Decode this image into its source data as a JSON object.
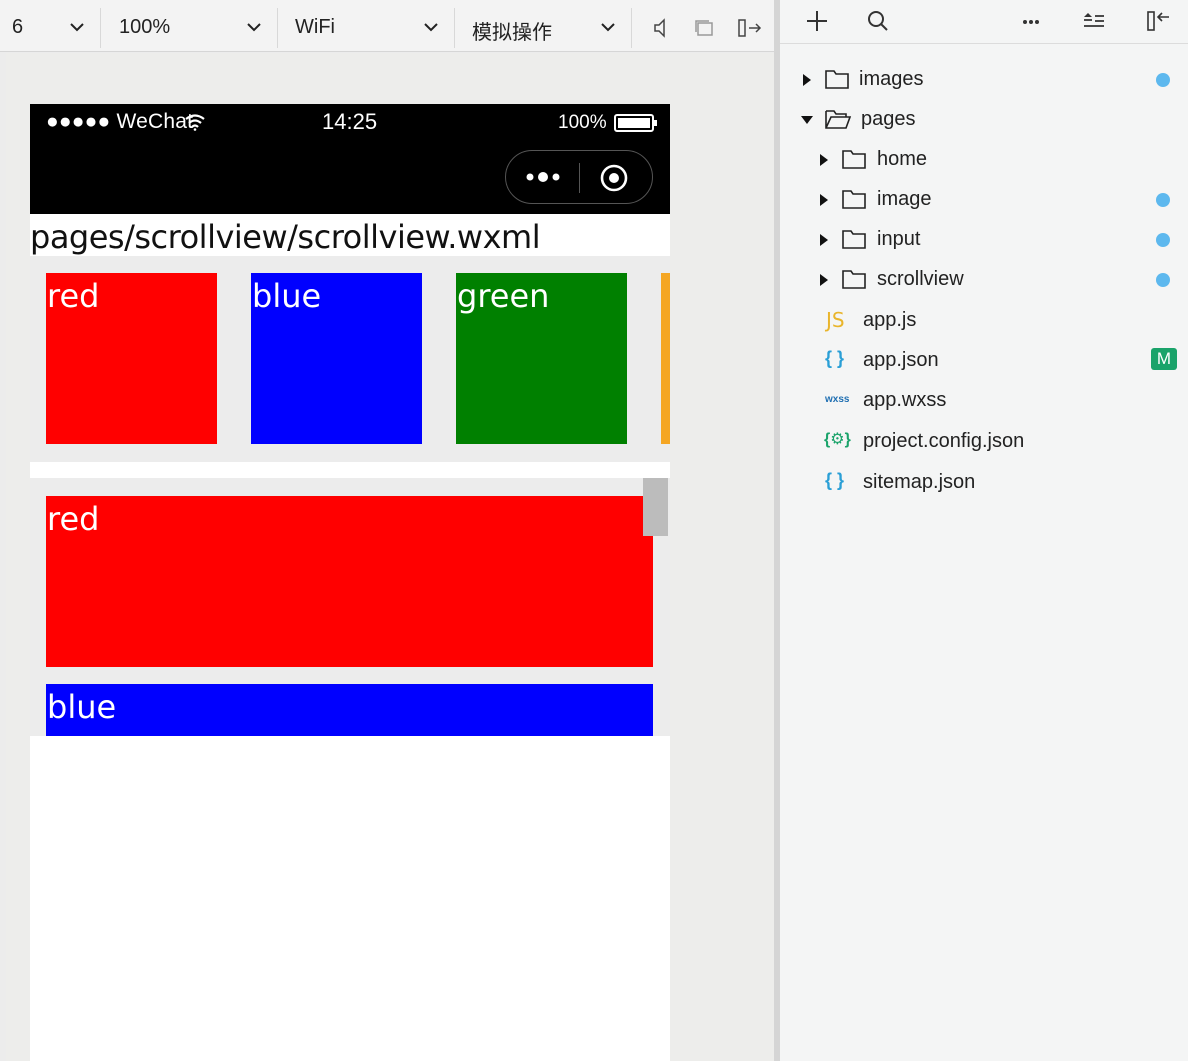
{
  "toolbar": {
    "device_value": "6",
    "zoom_value": "100%",
    "network_value": "WiFi",
    "simulate_value": "模拟操作"
  },
  "phone": {
    "carrier": "●●●●● WeChat",
    "time": "14:25",
    "battery_text": "100%",
    "page_path": "pages/scrollview/scrollview.wxml",
    "h_items": [
      "red",
      "blue",
      "green"
    ],
    "v_items": [
      "red",
      "blue"
    ],
    "colors": {
      "red": "#ff0000",
      "blue": "#0000ff",
      "green": "#008000",
      "orange": "#f5a623"
    }
  },
  "explorer": {
    "tree": [
      {
        "label": "images",
        "type": "folder",
        "expanded": false,
        "status": "dot"
      },
      {
        "label": "pages",
        "type": "folder",
        "expanded": true
      },
      {
        "label": "home",
        "type": "folder",
        "expanded": false
      },
      {
        "label": "image",
        "type": "folder",
        "expanded": false,
        "status": "dot"
      },
      {
        "label": "input",
        "type": "folder",
        "expanded": false,
        "status": "dot"
      },
      {
        "label": "scrollview",
        "type": "folder",
        "expanded": false,
        "status": "dot"
      },
      {
        "label": "app.js",
        "type": "file",
        "icon": "JS"
      },
      {
        "label": "app.json",
        "type": "file",
        "icon": "{ }",
        "status_badge": "M"
      },
      {
        "label": "app.wxss",
        "type": "file",
        "icon": "wxss"
      },
      {
        "label": "project.config.json",
        "type": "file",
        "icon": "{⚙}"
      },
      {
        "label": "sitemap.json",
        "type": "file",
        "icon": "{ }"
      }
    ],
    "accent_dot": "#5db8ee",
    "badge_color": "#1aa36a"
  }
}
